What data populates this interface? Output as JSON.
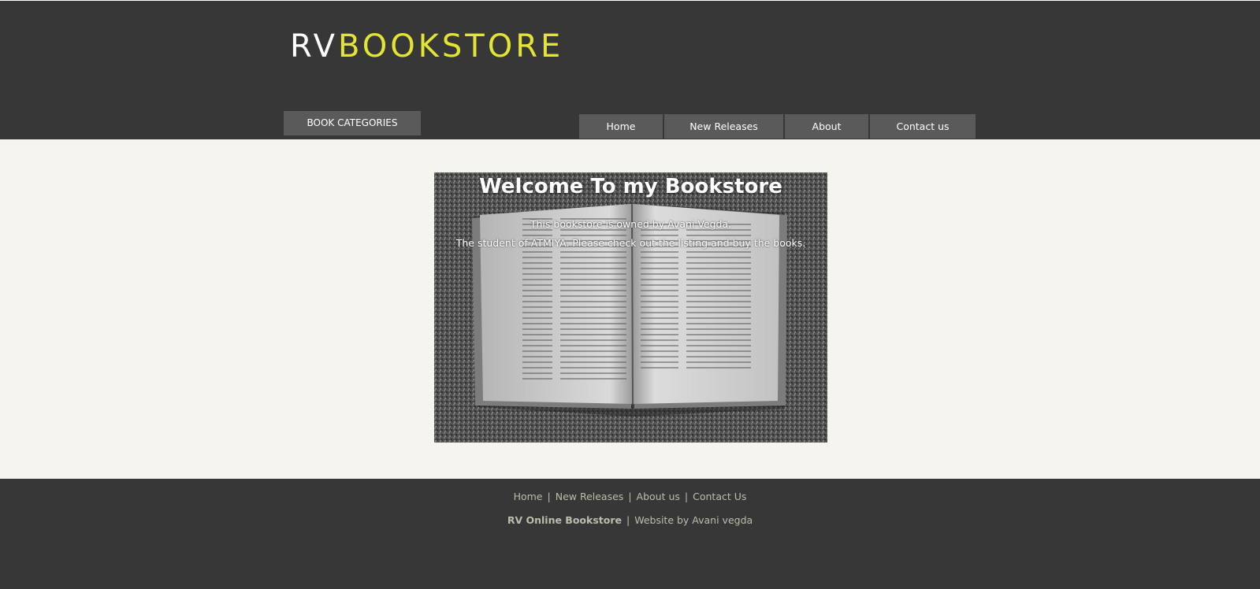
{
  "header": {
    "logo_prefix": "RV",
    "logo_main": "BOOKSTORE",
    "categories_button": "BOOK CATEGORIES",
    "nav": {
      "home": "Home",
      "new_releases": "New Releases",
      "about": "About",
      "contact": "Contact us"
    }
  },
  "hero": {
    "title": "Welcome To my Bookstore",
    "line1": "This bookstore is owned by Avani Vegda.",
    "line2": "The student of ATMIYA. Please check out the listing and buy the books."
  },
  "footer": {
    "links": {
      "home": "Home",
      "new_releases": "New Releases",
      "about": "About us",
      "contact": "Contact Us"
    },
    "separator": "|",
    "brand": "RV Online Bookstore",
    "credit": "Website by Avani vegda"
  },
  "colors": {
    "header_bg": "#373737",
    "logo_accent": "#e3e532",
    "nav_bg": "#5a5a5a",
    "page_bg": "#f5f4ef",
    "footer_text": "#bdbcac"
  }
}
